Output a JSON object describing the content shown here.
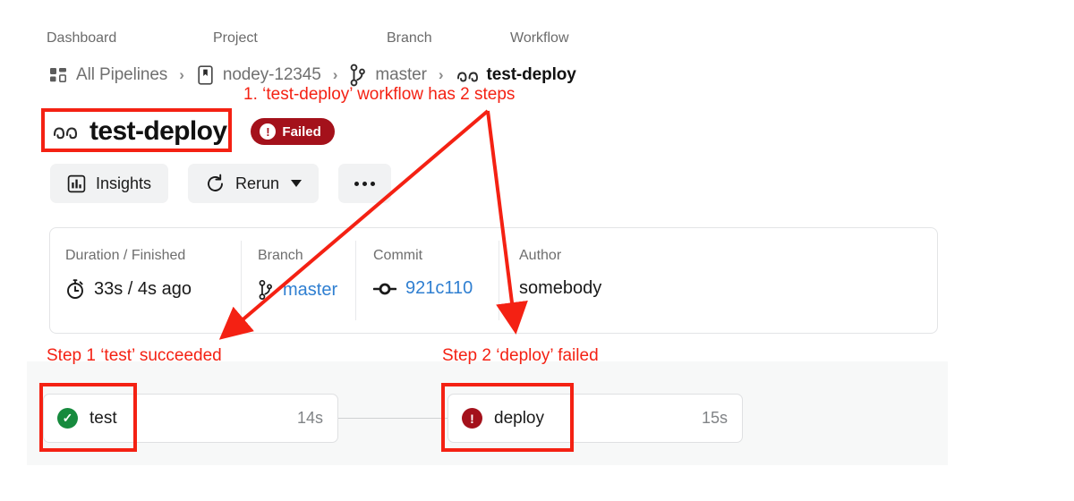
{
  "breadcrumb": {
    "labels": [
      "Dashboard",
      "Project",
      "Branch",
      "Workflow"
    ],
    "items": [
      {
        "icon": "pipelines-grid-icon",
        "text": "All Pipelines"
      },
      {
        "icon": "project-bookmark-icon",
        "text": "nodey-12345"
      },
      {
        "icon": "git-branch-icon",
        "text": "master"
      },
      {
        "icon": "workflow-icon",
        "text": "test-deploy"
      }
    ],
    "separator": "›"
  },
  "header": {
    "icon": "workflow-icon",
    "title": "test-deploy",
    "status": {
      "label": "Failed",
      "icon": "exclamation-icon",
      "color": "#a4111b"
    }
  },
  "toolbar": {
    "insights_label": "Insights",
    "rerun_label": "Rerun",
    "more_label": "⋯"
  },
  "info_card": {
    "cells": [
      {
        "key": "Duration / Finished",
        "value": "33s / 4s ago",
        "icon": "stopwatch-icon",
        "link": false
      },
      {
        "key": "Branch",
        "value": "master",
        "icon": "git-branch-icon",
        "link": true
      },
      {
        "key": "Commit",
        "value": "921c110",
        "icon": "git-commit-icon",
        "link": true
      },
      {
        "key": "Author",
        "value": "somebody",
        "icon": "",
        "link": false
      }
    ]
  },
  "steps": [
    {
      "name": "test",
      "duration": "14s",
      "status": "succeeded",
      "glyph": "✓",
      "color": "#168a3d"
    },
    {
      "name": "deploy",
      "duration": "15s",
      "status": "failed",
      "glyph": "!",
      "color": "#a4111b"
    }
  ],
  "annotations": {
    "color": "#f42113",
    "note_1": "1. ‘test-deploy’ workflow has 2 steps",
    "note_2": "Step 1 ‘test’ succeeded",
    "note_3": "Step 2 ‘deploy’ failed"
  }
}
